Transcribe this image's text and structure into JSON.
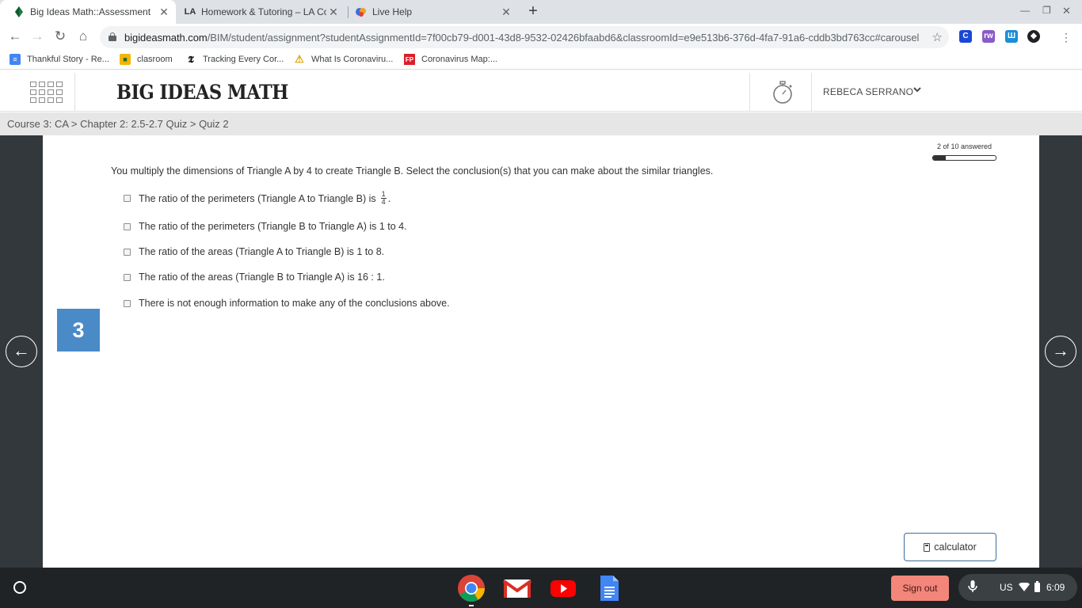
{
  "browser": {
    "tabs": [
      {
        "title": "Big Ideas Math::Assessment",
        "favicon": "big-ideas-leaf-icon",
        "active": true
      },
      {
        "title": "Homework & Tutoring – LA Cou",
        "favicon": "la-logo-icon",
        "active": false
      },
      {
        "title": "Live Help",
        "favicon": "live-help-icon",
        "active": false
      }
    ],
    "url_host": "bigideasmath.com",
    "url_path": "/BIM/student/assignment?studentAssignmentId=7f00cb79-d001-43d8-9532-02426bfaabd6&classroomId=e9e513b6-376d-4fa7-91a6-cddb3bd763cc#carousel",
    "bookmarks": [
      {
        "label": "Thankful Story - Re...",
        "icon": "google-docs-icon"
      },
      {
        "label": "clasroom",
        "icon": "google-classroom-icon"
      },
      {
        "label": "Tracking Every Cor...",
        "icon": "nytimes-icon"
      },
      {
        "label": "What Is Coronaviru...",
        "icon": "warning-icon"
      },
      {
        "label": "Coronavirus Map:...",
        "icon": "fp-icon"
      }
    ]
  },
  "site": {
    "brand": "BIG IDEAS MATH",
    "user_name": "REBECA SERRANO",
    "breadcrumb": "Course 3: CA > Chapter 2: 2.5-2.7 Quiz > Quiz 2"
  },
  "assessment": {
    "progress_text": "2 of 10 answered",
    "progress_fraction": 0.2,
    "question_number": "3",
    "question": "You multiply the dimensions of Triangle A by 4 to create Triangle B. Select the conclusion(s) that you can make about the similar triangles.",
    "option1_text": "The ratio of the perimeters (Triangle A to Triangle B) is",
    "option1_fraction_num": "1",
    "option1_fraction_den": "4",
    "option1_suffix": ".",
    "options": [
      "The ratio of the perimeters (Triangle B to Triangle A) is 1 to 4.",
      "The ratio of the areas (Triangle A to Triangle B) is 1 to 8.",
      "The ratio of the areas (Triangle B to Triangle A) is 16 : 1.",
      "There is not enough information to make any of the conclusions above."
    ],
    "calculator_label": "calculator",
    "prev_arrow": "←",
    "next_arrow": "→"
  },
  "shelf": {
    "sign_out": "Sign out",
    "keyboard_layout": "US",
    "time": "6:09"
  }
}
